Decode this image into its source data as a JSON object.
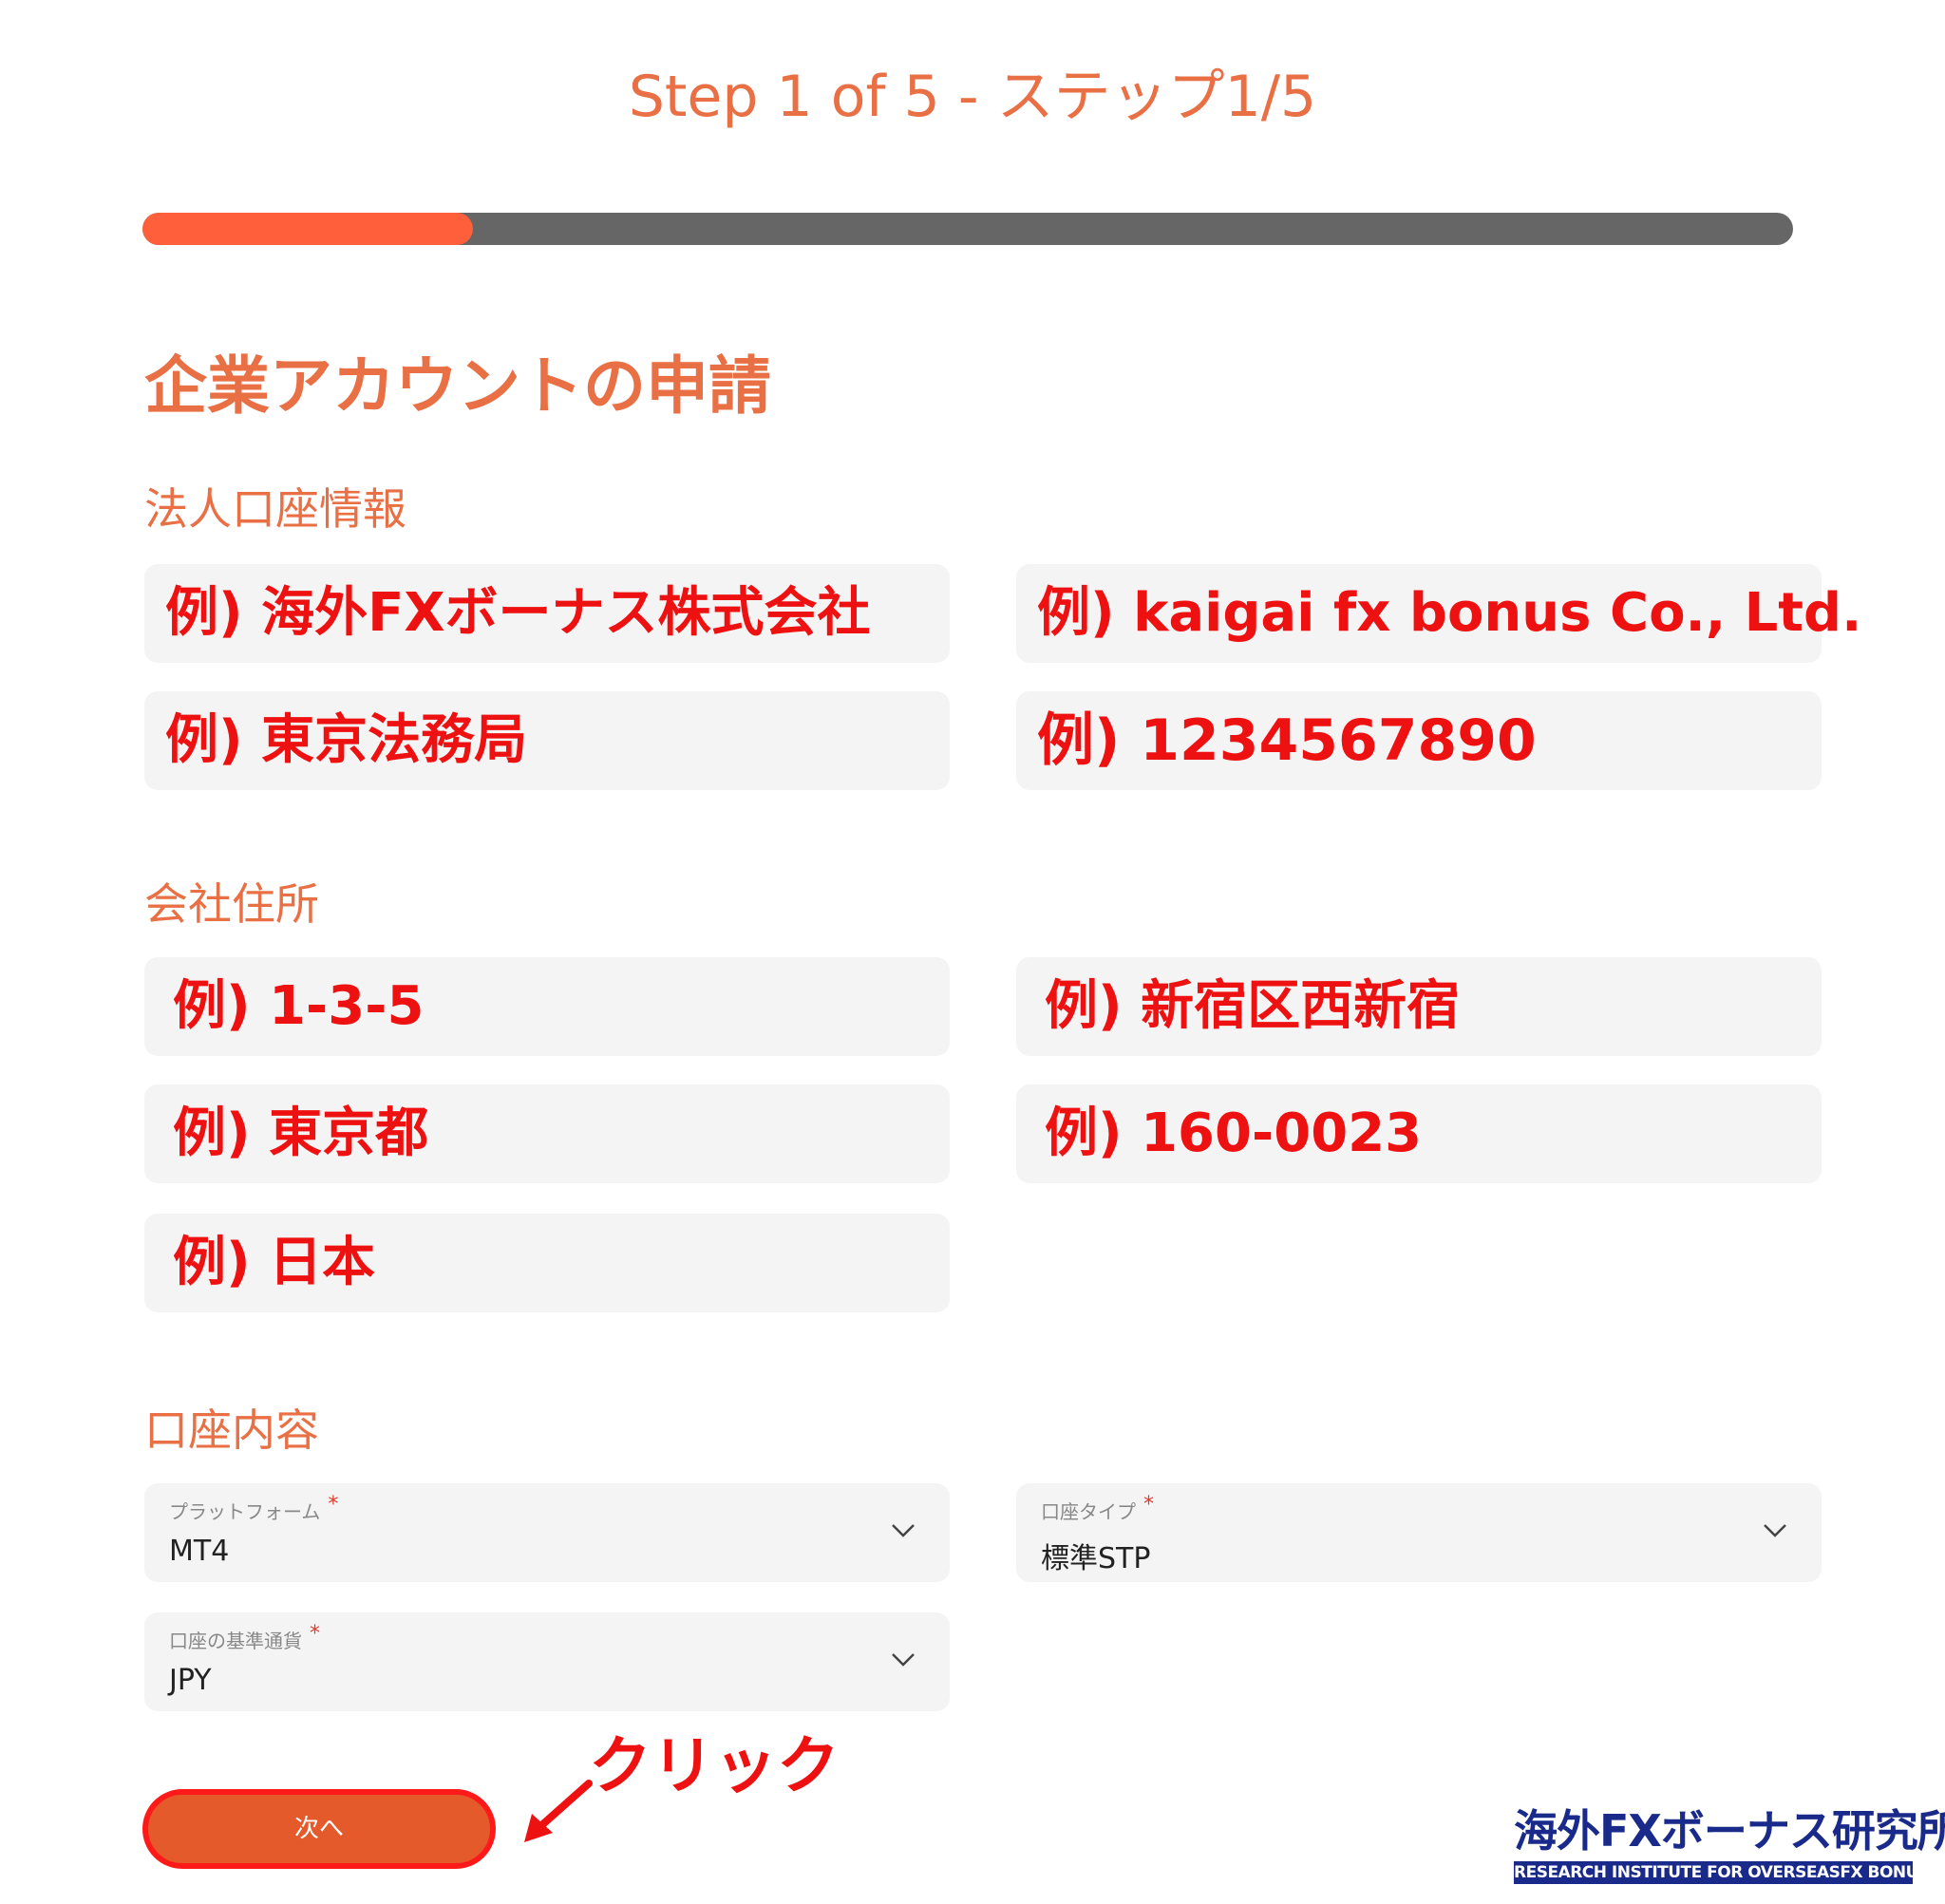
{
  "header": {
    "step_title": "Step 1 of 5 - ステップ1/5",
    "progress": 0.2
  },
  "form": {
    "title": "企業アカウントの申請",
    "sections": {
      "corporate_account_info": {
        "label": "法人口座情報",
        "fields": [
          "例) 海外FXボーナス株式会社",
          "例) kaigai fx bonus Co., Ltd.",
          "例) 東京法務局",
          "例) 1234567890"
        ]
      },
      "company_address": {
        "label": "会社住所",
        "fields": [
          "例) 1-3-5",
          "例) 新宿区西新宿",
          "例) 東京都",
          "例) 160-0023",
          "例) 日本"
        ]
      },
      "account_details": {
        "label": "口座内容",
        "platform": {
          "label": "プラットフォーム",
          "required_mark": "*",
          "value": "MT4"
        },
        "account_type": {
          "label": "口座タイプ",
          "required_mark": "*",
          "value": "標準STP"
        },
        "base_currency": {
          "label": "口座の基準通貨",
          "required_mark": "*",
          "value": "JPY"
        }
      }
    },
    "next_button_label": "次へ"
  },
  "annotation": {
    "click_label": "クリック",
    "color": "#ee1111"
  },
  "watermark": {
    "main": "海外FXボーナス研究所",
    "sub": "RESEARCH INSTITUTE FOR OVERSEASFX BONUS"
  },
  "colors": {
    "accent": "#e96f45",
    "progress_fill": "#ff5f3a",
    "progress_track": "#666666",
    "button": "#e55a2b"
  }
}
